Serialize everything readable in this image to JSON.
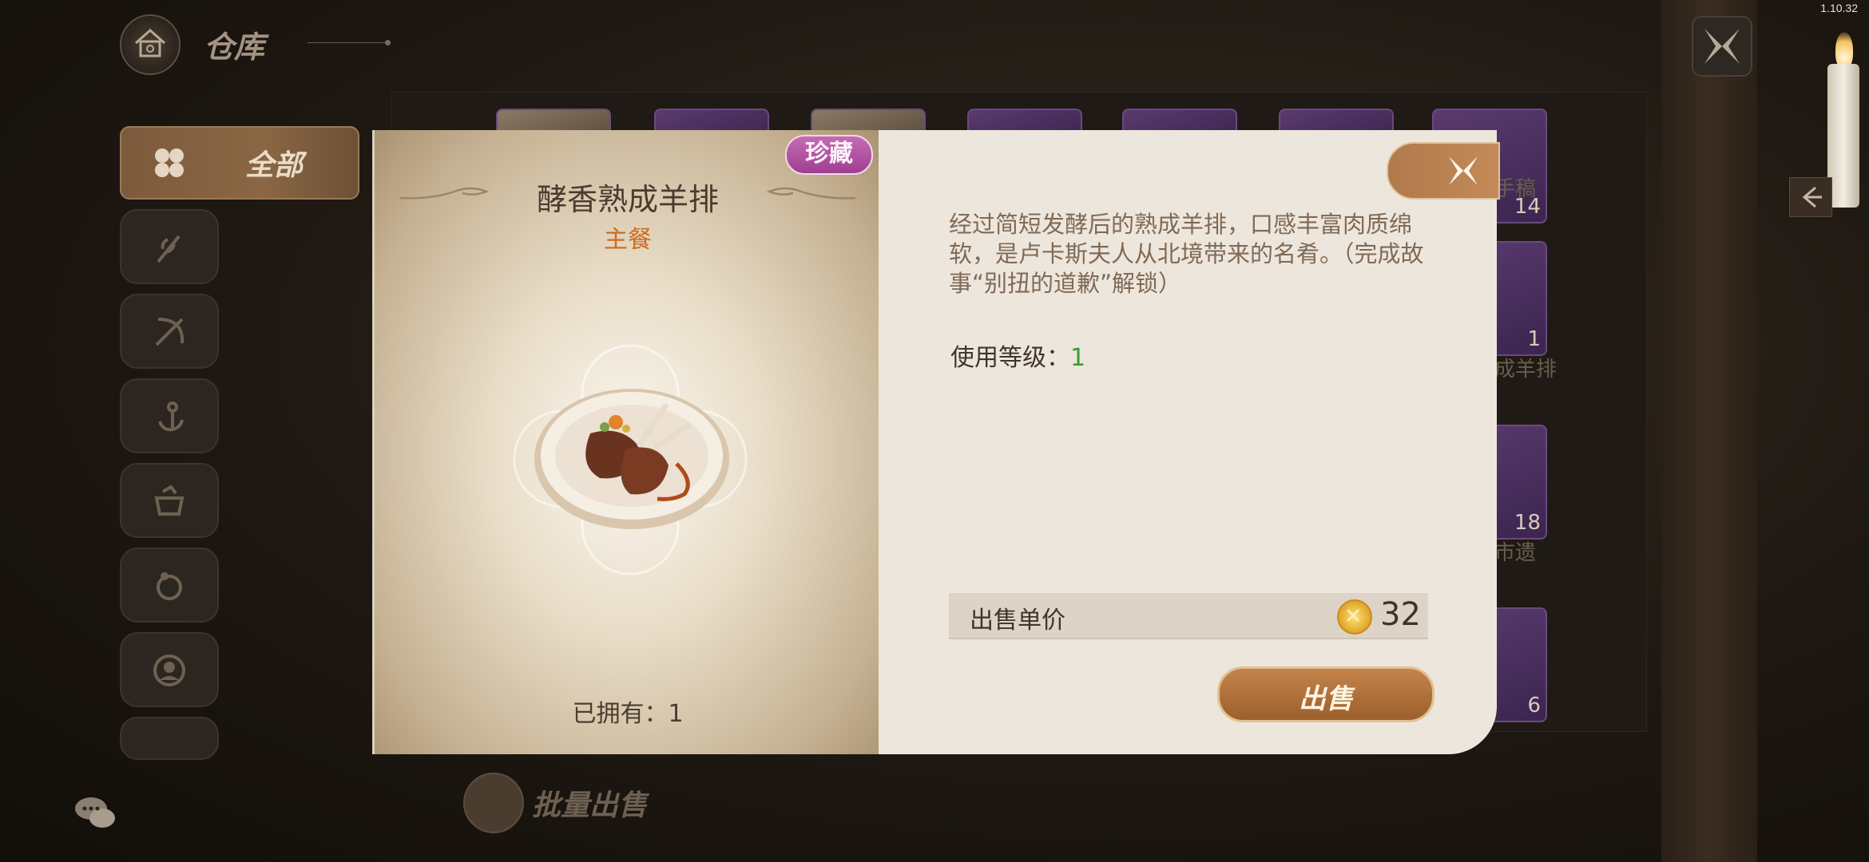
{
  "version": "1.10.32",
  "header": {
    "title": "仓库"
  },
  "sidebar": {
    "all_label": "全部"
  },
  "bulk_sell_label": "批量出售",
  "grid": {
    "slots": [
      {
        "count": "14",
        "name": "手稿"
      },
      {
        "count": "1",
        "name": "成羊排"
      },
      {
        "count": "18",
        "name": "市遗"
      },
      {
        "count": "6",
        "name": ""
      }
    ]
  },
  "item": {
    "rarity_badge": "珍藏",
    "name": "酵香熟成羊排",
    "type": "主餐",
    "owned_text": "已拥有：1",
    "description": "经过简短发酵后的熟成羊排，口感丰富肉质绵软，是卢卡斯夫人从北境带来的名肴。（完成故事“别扭的道歉”解锁）",
    "level_label": "使用等级：",
    "level_value": "1",
    "price_label": "出售单价",
    "price_value": "32",
    "sell_label": "出售"
  },
  "colors": {
    "badge": "#b452a4",
    "type": "#d16a1f",
    "level_value": "#3a9a2c",
    "sell_button": "#b07440"
  },
  "icons": [
    "home-icon",
    "close-icon",
    "clover-icon",
    "wheat-icon",
    "bow-icon",
    "anchor-icon",
    "cooking-pot-icon",
    "ring-icon",
    "portrait-icon",
    "chat-icon",
    "coin-icon",
    "back-arrow-icon"
  ]
}
